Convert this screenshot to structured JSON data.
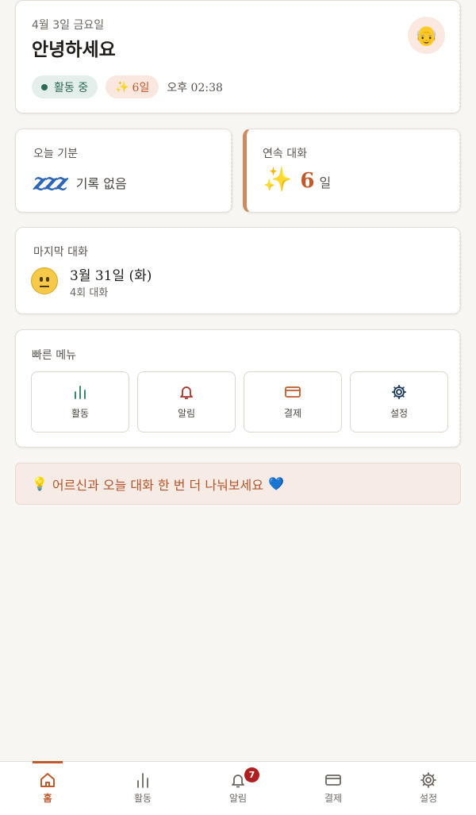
{
  "header": {
    "date": "4월 3일 금요일",
    "greeting": "안녕하세요",
    "avatar_icon": "elderly-person-icon",
    "status_badge": "활동 중",
    "streak_badge": "6일",
    "time": "오후 02:38"
  },
  "mood": {
    "label": "오늘 기분",
    "icon": "zzz-sleep-icon",
    "icon_text": "zzz",
    "value": "기록 없음"
  },
  "streak": {
    "label": "연속 대화",
    "icon": "sparkles-icon",
    "count": "6",
    "unit": "일"
  },
  "last_conversation": {
    "label": "마지막 대화",
    "icon": "neutral-face-icon",
    "date": "3월 31일 (화)",
    "count": "4회 대화"
  },
  "quick_menu": {
    "title": "빠른 메뉴",
    "items": [
      {
        "label": "활동",
        "icon": "bar-chart-icon"
      },
      {
        "label": "알림",
        "icon": "bell-icon"
      },
      {
        "label": "결제",
        "icon": "credit-card-icon"
      },
      {
        "label": "설정",
        "icon": "gear-icon"
      }
    ]
  },
  "tip": {
    "text": "어르신과 오늘 대화 한 번 더 나눠보세요"
  },
  "nav": {
    "items": [
      {
        "label": "홈",
        "icon": "home-icon",
        "active": true
      },
      {
        "label": "활동",
        "icon": "bar-chart-icon"
      },
      {
        "label": "알림",
        "icon": "bell-icon",
        "badge": "7"
      },
      {
        "label": "결제",
        "icon": "credit-card-icon"
      },
      {
        "label": "설정",
        "icon": "gear-icon"
      }
    ]
  },
  "colors": {
    "accent": "#c15a2a",
    "background": "#f8f6f3",
    "active_green": "#2e6b55",
    "badge_red": "#b01f1f"
  }
}
